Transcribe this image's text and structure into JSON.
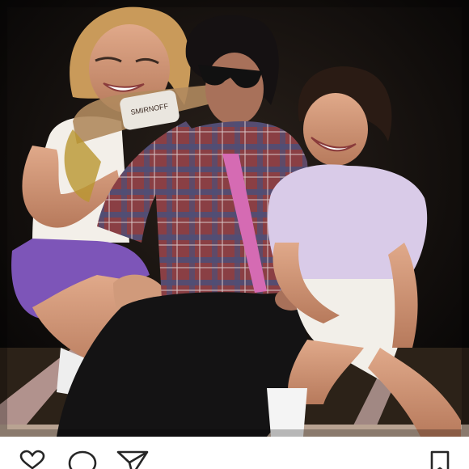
{
  "post": {
    "image": {
      "kind": "photo",
      "visible_label_text": "SMIRNOFF"
    }
  },
  "actions": {
    "left": [
      {
        "name": "like",
        "icon": "heart-icon"
      },
      {
        "name": "comment",
        "icon": "comment-bubble-icon"
      },
      {
        "name": "share",
        "icon": "paper-plane-icon"
      }
    ],
    "right": [
      {
        "name": "save",
        "icon": "bookmark-icon"
      }
    ]
  },
  "colors": {
    "background": "#ffffff",
    "photo_background": "#0d0b0a",
    "icon_stroke": "#262626"
  }
}
